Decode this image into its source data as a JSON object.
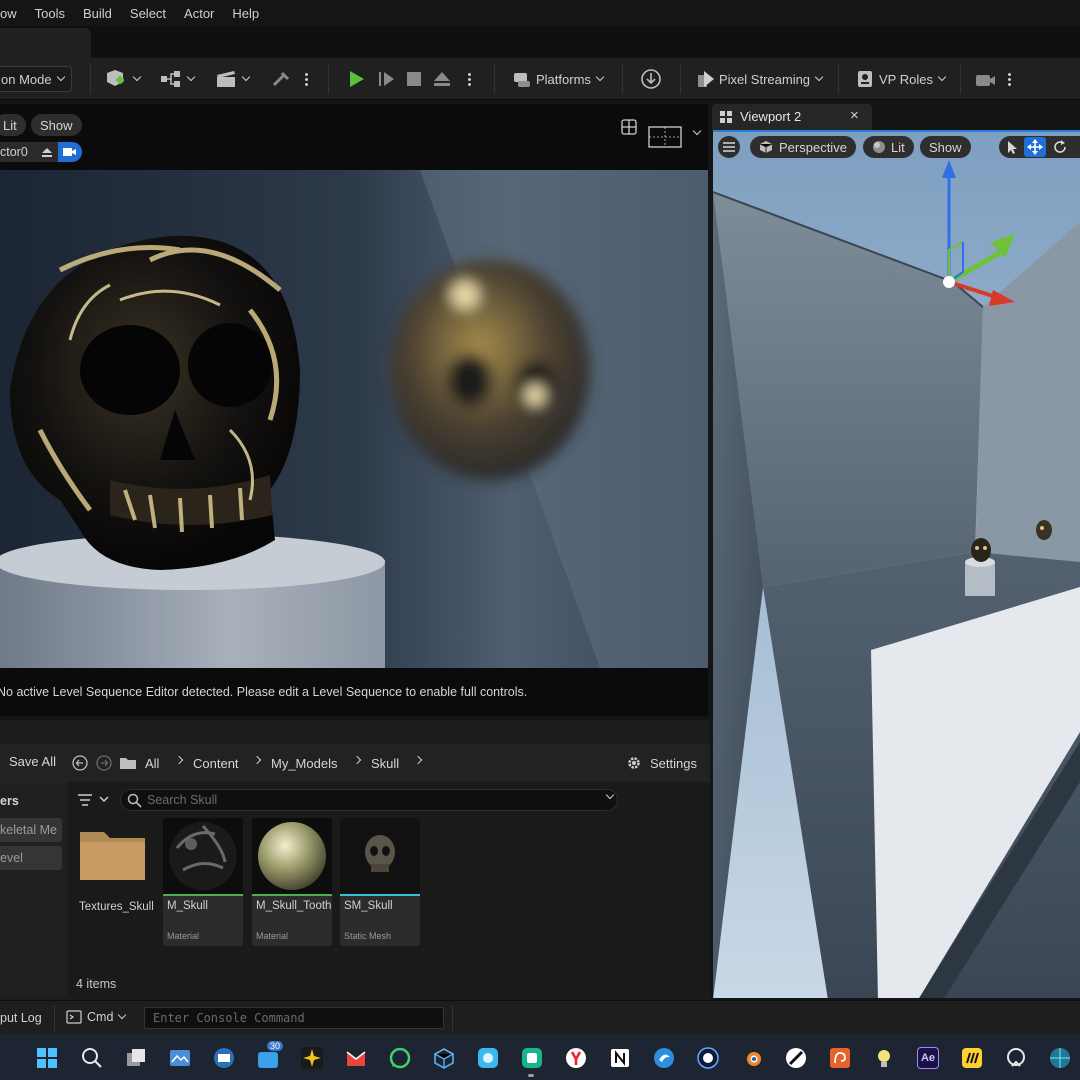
{
  "menu": {
    "items": [
      "ow",
      "Tools",
      "Build",
      "Select",
      "Actor",
      "Help"
    ]
  },
  "toolbar": {
    "mode_label": "on Mode",
    "platforms_label": "Platforms",
    "pixel_streaming_label": "Pixel Streaming",
    "vp_roles_label": "VP Roles"
  },
  "viewport1": {
    "lit_label": "Lit",
    "show_label": "Show",
    "actor_label": "ctor0",
    "sequence_message": "No active Level Sequence Editor detected. Please edit a Level Sequence to enable full controls."
  },
  "viewport2": {
    "tab_title": "Viewport 2",
    "close_glyph": "×",
    "perspective_label": "Perspective",
    "lit_label": "Lit",
    "show_label": "Show"
  },
  "content_browser": {
    "save_all_label": "Save All",
    "breadcrumb": [
      "All",
      "Content",
      "My_Models",
      "Skull"
    ],
    "settings_label": "Settings",
    "search_placeholder": "Search Skull",
    "left_header": "ers",
    "left_items": [
      "keletal Me",
      "evel"
    ],
    "items_count": "4 items",
    "assets": [
      {
        "name": "Textures_Skull",
        "type": ""
      },
      {
        "name": "M_Skull",
        "type": "Material"
      },
      {
        "name": "M_Skull_Tooth",
        "type": "Material"
      },
      {
        "name": "SM_Skull",
        "type": "Static Mesh"
      }
    ]
  },
  "output": {
    "output_log_label": "put Log",
    "cmd_label": "Cmd",
    "console_placeholder": "Enter Console Command"
  },
  "taskbar": {
    "badge_count": "30",
    "ae_label": "Ae"
  },
  "colors": {
    "accent_blue": "#2a7fd4",
    "play_green": "#5ac13a",
    "material_bar": "#4caf50",
    "mesh_bar": "#33c3d6"
  }
}
